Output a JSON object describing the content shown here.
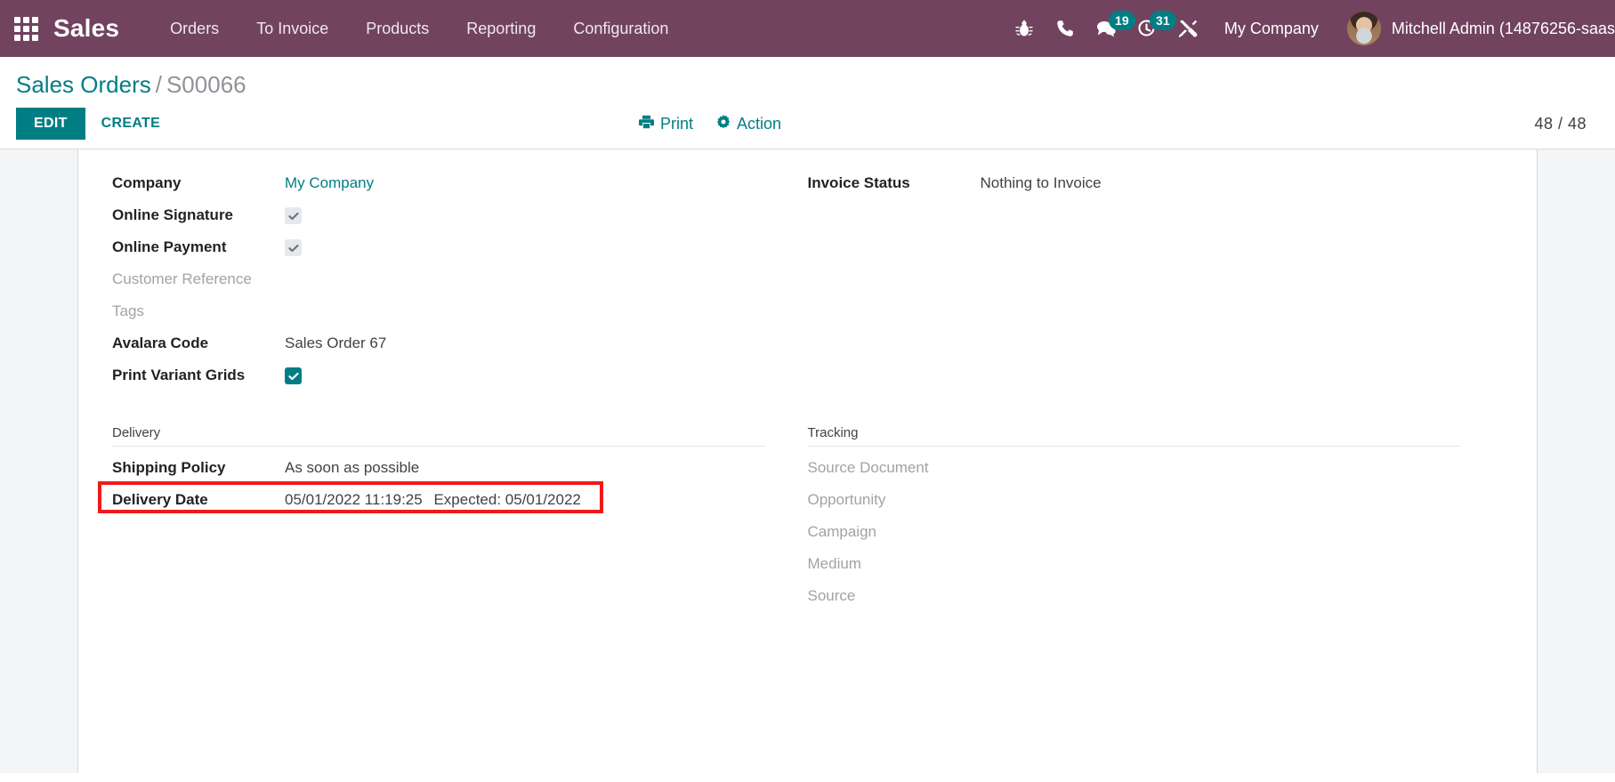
{
  "navbar": {
    "apps_icon": "apps-grid-icon",
    "brand": "Sales",
    "menu": [
      {
        "label": "Orders"
      },
      {
        "label": "To Invoice"
      },
      {
        "label": "Products"
      },
      {
        "label": "Reporting"
      },
      {
        "label": "Configuration"
      }
    ],
    "sys_icons": [
      {
        "name": "bug-icon",
        "badge": null
      },
      {
        "name": "phone-icon",
        "badge": null
      },
      {
        "name": "messages-icon",
        "badge": "19"
      },
      {
        "name": "activities-icon",
        "badge": "31"
      },
      {
        "name": "tools-icon",
        "badge": null
      }
    ],
    "company": "My Company",
    "user": "Mitchell Admin (14876256-saas",
    "accent_purple": "#71435F",
    "badge_color": "#017E84"
  },
  "control_panel": {
    "breadcrumb_root": "Sales Orders",
    "breadcrumb_sep": "/",
    "breadcrumb_current": "S00066",
    "edit_label": "EDIT",
    "create_label": "CREATE",
    "print_label": "Print",
    "print_icon": "printer-icon",
    "action_label": "Action",
    "action_icon": "gear-icon",
    "pager": "48 / 48"
  },
  "form": {
    "left": [
      {
        "label": "Company",
        "value": "My Company",
        "type": "link"
      },
      {
        "label": "Online Signature",
        "type": "checkbox-disabled",
        "checked": true
      },
      {
        "label": "Online Payment",
        "type": "checkbox-disabled",
        "checked": true
      },
      {
        "label": "Customer Reference",
        "value": "",
        "type": "empty"
      },
      {
        "label": "Tags",
        "value": "",
        "type": "empty"
      },
      {
        "label": "Avalara Code",
        "value": "Sales Order 67",
        "type": "text"
      },
      {
        "label": "Print Variant Grids",
        "type": "checkbox-on",
        "checked": true
      }
    ],
    "right": [
      {
        "label": "Invoice Status",
        "value": "Nothing to Invoice",
        "type": "text"
      }
    ]
  },
  "sections": {
    "delivery": {
      "title": "Delivery",
      "rows": [
        {
          "label": "Shipping Policy",
          "value": "As soon as possible",
          "type": "text"
        },
        {
          "label": "Delivery Date",
          "value": "05/01/2022 11:19:25",
          "hint": "Expected: 05/01/2022",
          "type": "date",
          "highlighted": true
        }
      ]
    },
    "tracking": {
      "title": "Tracking",
      "rows": [
        {
          "label": "Source Document",
          "value": "",
          "type": "empty"
        },
        {
          "label": "Opportunity",
          "value": "",
          "type": "empty"
        },
        {
          "label": "Campaign",
          "value": "",
          "type": "empty"
        },
        {
          "label": "Medium",
          "value": "",
          "type": "empty"
        },
        {
          "label": "Source",
          "value": "",
          "type": "empty"
        }
      ]
    }
  },
  "annotation": {
    "color": "#EF1A1A",
    "target": "Delivery Date"
  }
}
